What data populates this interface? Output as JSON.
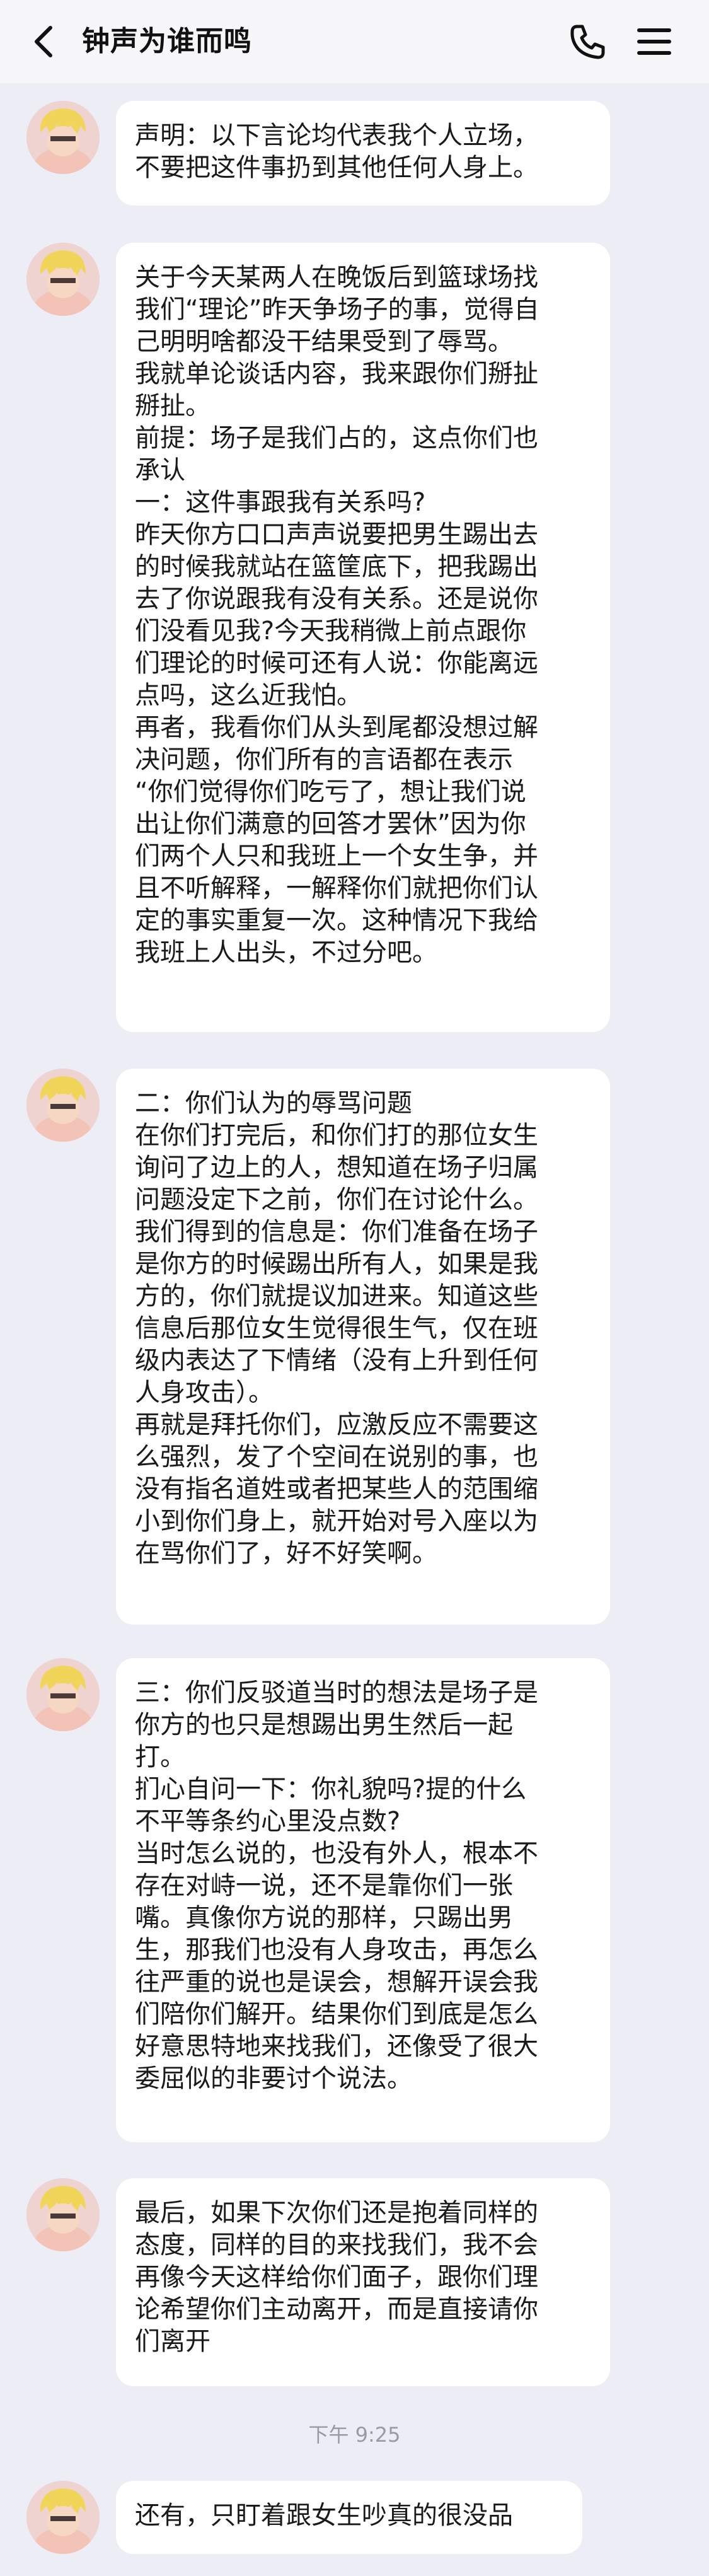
{
  "header": {
    "title": "钟声为谁而鸣"
  },
  "messages": [
    {
      "text": "声明：以下言论均代表我个人立场，\n不要把这件事扔到其他任何人身上。"
    },
    {
      "text": "关于今天某两人在晚饭后到篮球场找\n我们“理论”昨天争场子的事，觉得自\n己明明啥都没干结果受到了辱骂。\n我就单论谈话内容，我来跟你们掰扯\n掰扯。\n前提：场子是我们占的，这点你们也\n承认\n一：这件事跟我有关系吗?\n昨天你方口口声声说要把男生踢出去\n的时候我就站在篮筐底下，把我踢出\n去了你说跟我有没有关系。还是说你\n们没看见我?今天我稍微上前点跟你\n们理论的时候可还有人说：你能离远\n点吗，这么近我怕。\n再者，我看你们从头到尾都没想过解\n决问题，你们所有的言语都在表示\n“你们觉得你们吃亏了，想让我们说\n出让你们满意的回答才罢休”因为你\n们两个人只和我班上一个女生争，并\n且不听解释，一解释你们就把你们认\n定的事实重复一次。这种情况下我给\n我班上人出头，不过分吧。"
    },
    {
      "text": "二：你们认为的辱骂问题\n在你们打完后，和你们打的那位女生\n询问了边上的人，想知道在场子归属\n问题没定下之前，你们在讨论什么。\n我们得到的信息是：你们准备在场子\n是你方的时候踢出所有人，如果是我\n方的，你们就提议加进来。知道这些\n信息后那位女生觉得很生气，仅在班\n级内表达了下情绪（没有上升到任何\n人身攻击）。\n再就是拜托你们，应激反应不需要这\n么强烈，发了个空间在说别的事，也\n没有指名道姓或者把某些人的范围缩\n小到你们身上，就开始对号入座以为\n在骂你们了，好不好笑啊。"
    },
    {
      "text": "三：你们反驳道当时的想法是场子是\n你方的也只是想踢出男生然后一起\n打。\n扪心自问一下：你礼貌吗?提的什么\n不平等条约心里没点数?\n当时怎么说的，也没有外人，根本不\n存在对峙一说，还不是靠你们一张\n嘴。真像你方说的那样，只踢出男\n生，那我们也没有人身攻击，再怎么\n往严重的说也是误会，想解开误会我\n们陪你们解开。结果你们到底是怎么\n好意思特地来找我们，还像受了很大\n委屈似的非要讨个说法。"
    },
    {
      "text": "最后，如果下次你们还是抱着同样的\n态度，同样的目的来找我们，我不会\n再像今天这样给你们面子，跟你们理\n论希望你们主动离开，而是直接请你\n们离开"
    },
    {
      "text": "还有，只盯着跟女生吵真的很没品"
    }
  ],
  "timestamp": "下午 9:25",
  "colors": {
    "background": "#ededf6",
    "bubble": "#ffffff",
    "header": "#f7f7fa"
  }
}
